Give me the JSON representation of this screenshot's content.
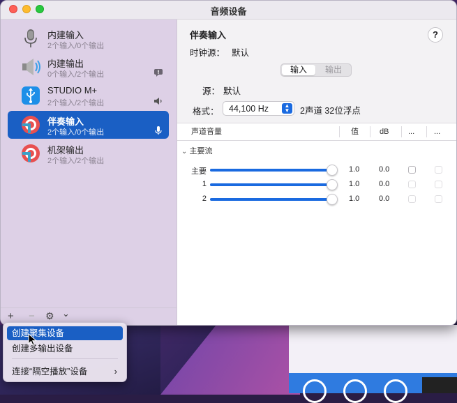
{
  "window": {
    "title": "音频设备"
  },
  "sidebar": {
    "devices": [
      {
        "name": "内建输入",
        "sub": "2个输入/0个输出",
        "icon": "microphone-icon",
        "badge": ""
      },
      {
        "name": "内建输出",
        "sub": "0个输入/2个输出",
        "icon": "speaker-icon",
        "badge": "alert-bubble-icon"
      },
      {
        "name": "STUDIO M+",
        "sub": "2个输入/2个输出",
        "icon": "usb-icon",
        "badge": "volume-icon"
      },
      {
        "name": "伴奏输入",
        "sub": "2个输入/0个输出",
        "icon": "loopback-icon",
        "badge": "microphone-small-icon",
        "selected": true
      },
      {
        "name": "机架输出",
        "sub": "2个输入/2个输出",
        "icon": "loopback-icon",
        "badge": ""
      }
    ],
    "toolbar": {
      "add": "+",
      "remove": "−",
      "gear": "⚙",
      "chevron": "⌄"
    }
  },
  "detail": {
    "title": "伴奏输入",
    "clock_label": "时钟源：",
    "clock_value": "默认",
    "help": "?",
    "tabs": {
      "input": "输入",
      "output": "输出"
    },
    "source_label": "源：",
    "source_value": "默认",
    "format_label": "格式：",
    "format_value": "44,100 Hz",
    "format_desc": "2声道 32位浮点"
  },
  "table": {
    "headers": {
      "channel": "声道音量",
      "value": "值",
      "db": "dB",
      "c1": "...",
      "c2": "..."
    },
    "group": "主要流",
    "rows": [
      {
        "label": "主要",
        "value": "1.0",
        "db": "0.0"
      },
      {
        "label": "1",
        "value": "1.0",
        "db": "0.0"
      },
      {
        "label": "2",
        "value": "1.0",
        "db": "0.0"
      }
    ]
  },
  "menu": {
    "items": [
      {
        "label": "创建聚集设备",
        "highlighted": true
      },
      {
        "label": "创建多输出设备"
      },
      {
        "label": "连接“隔空播放”设备",
        "submenu": "›"
      }
    ]
  },
  "colors": {
    "accent": "#1a5fc4",
    "sidebar": "#ddd0e6"
  }
}
